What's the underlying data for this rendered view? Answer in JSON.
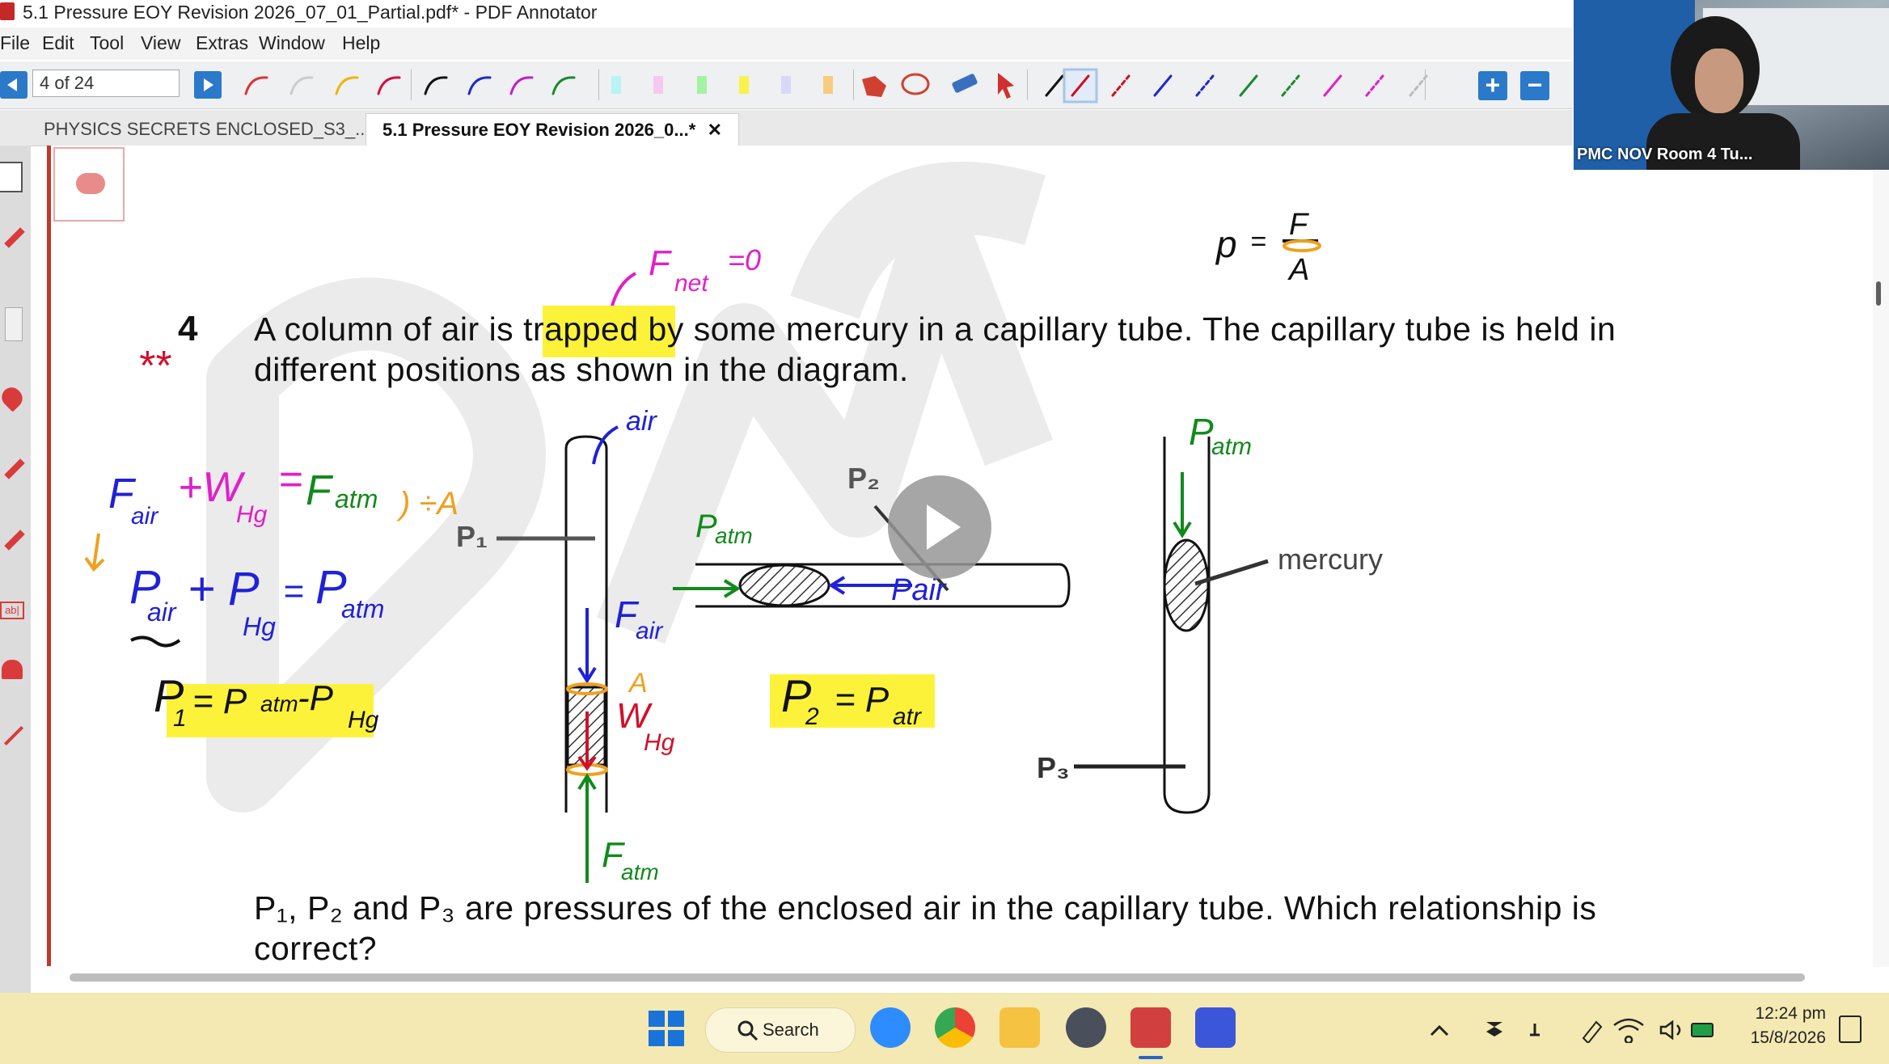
{
  "window": {
    "title": "5.1 Pressure EOY Revision 2026_07_01_Partial.pdf* - PDF Annotator"
  },
  "menu": [
    "File",
    "Edit",
    "Tool",
    "View",
    "Extras",
    "Window",
    "Help"
  ],
  "toolbar": {
    "page_indicator": "4 of 24"
  },
  "tabs": [
    {
      "label": "PHYSICS SECRETS ENCLOSED_S3_...*"
    },
    {
      "label": "5.1 Pressure EOY Revision 2026_0...*",
      "close": "✕"
    }
  ],
  "webcam": {
    "label": "PMC NOV Room 4 Tu..."
  },
  "question": {
    "number": "4",
    "line1_a": "A column of air is ",
    "line1_hl": "trapped",
    "line1_b": " by some mercury in a capillary tube. The capillary tube is held in",
    "line2": "different positions as shown in the diagram.",
    "bottom_line1": "P₁, P₂ and P₃ are pressures of the enclosed air in the capillary tube.  Which relationship is",
    "bottom_line2": "correct?"
  },
  "diagram": {
    "label_p1": "P₁",
    "label_p2": "P₂",
    "label_p3": "P₃",
    "label_mercury": "mercury"
  },
  "annotations": {
    "stars": "**",
    "formula_p": "p",
    "formula_eq": "=",
    "formula_f": "F",
    "formula_a": "A",
    "fnet": "F",
    "fnet_sub": "net",
    "fnet_eq": "=0",
    "air_arrow": "air",
    "eq1_fair": "F",
    "eq1_fair_sub": "air",
    "eq1_whg": "+W",
    "eq1_whg_sub": "Hg",
    "eq1_eq": "=",
    "eq1_fatm": "F",
    "eq1_fatm_sub": "atm",
    "div_a": ") ÷A",
    "eq2_pair": "P",
    "eq2_pair_sub": "air",
    "eq2_phg": "+ P",
    "eq2_phg_sub": "Hg",
    "eq2_eq": "=",
    "eq2_patm": "P",
    "eq2_patm_sub": "atm",
    "eq3": "P",
    "eq3_sub": "1",
    "eq3_rest": "= P",
    "eq3_atm": "atm",
    "eq3_minus": "-P",
    "eq3_hg": "Hg",
    "tube_fair": "F",
    "tube_fair_sub": "air",
    "tube_a": "A",
    "tube_whg": "W",
    "tube_whg_sub": "Hg",
    "tube_fatm": "F",
    "tube_fatm_sub": "atm",
    "patm2": "P",
    "patm2_sub": "atm",
    "pair2": "Pair",
    "eq4": "P",
    "eq4_sub": "2",
    "eq4_rest": "= P",
    "eq4_atm": "atr",
    "patm3": "P",
    "patm3_sub": "atm"
  },
  "taskbar": {
    "search_label": "Search",
    "time": "12:24 pm",
    "date": "15/8/2026"
  },
  "colors": {
    "highlight": "#fdf23a",
    "ink_blue": "#1f22d6",
    "ink_green": "#118a1c",
    "ink_red": "#d0102a",
    "ink_magenta": "#e020c8",
    "ink_orange": "#f0a020"
  }
}
